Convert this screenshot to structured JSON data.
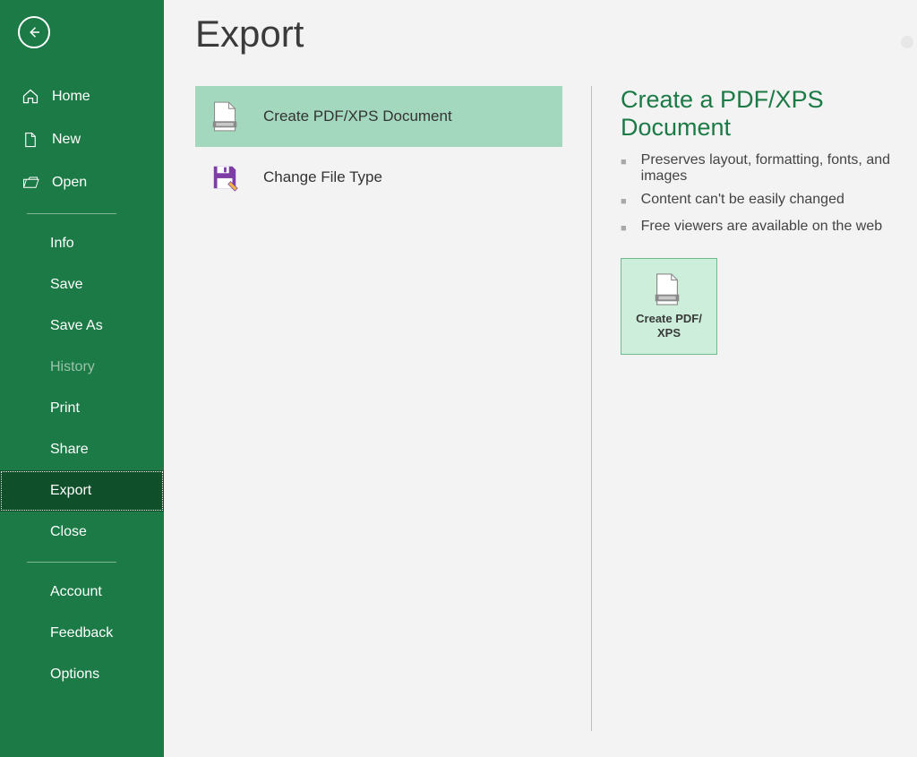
{
  "heading": "Export",
  "sidebar": {
    "items": [
      {
        "label": "Home"
      },
      {
        "label": "New"
      },
      {
        "label": "Open"
      },
      {
        "label": "Info"
      },
      {
        "label": "Save"
      },
      {
        "label": "Save As"
      },
      {
        "label": "History"
      },
      {
        "label": "Print"
      },
      {
        "label": "Share"
      },
      {
        "label": "Export"
      },
      {
        "label": "Close"
      },
      {
        "label": "Account"
      },
      {
        "label": "Feedback"
      },
      {
        "label": "Options"
      }
    ]
  },
  "export_options": {
    "items": [
      {
        "label": "Create PDF/XPS Document"
      },
      {
        "label": "Change File Type"
      }
    ]
  },
  "detail": {
    "title": "Create a PDF/XPS Document",
    "bullets": [
      "Preserves layout, formatting, fonts, and images",
      "Content can't be easily changed",
      "Free viewers are available on the web"
    ],
    "button_label": "Create PDF/\nXPS"
  }
}
